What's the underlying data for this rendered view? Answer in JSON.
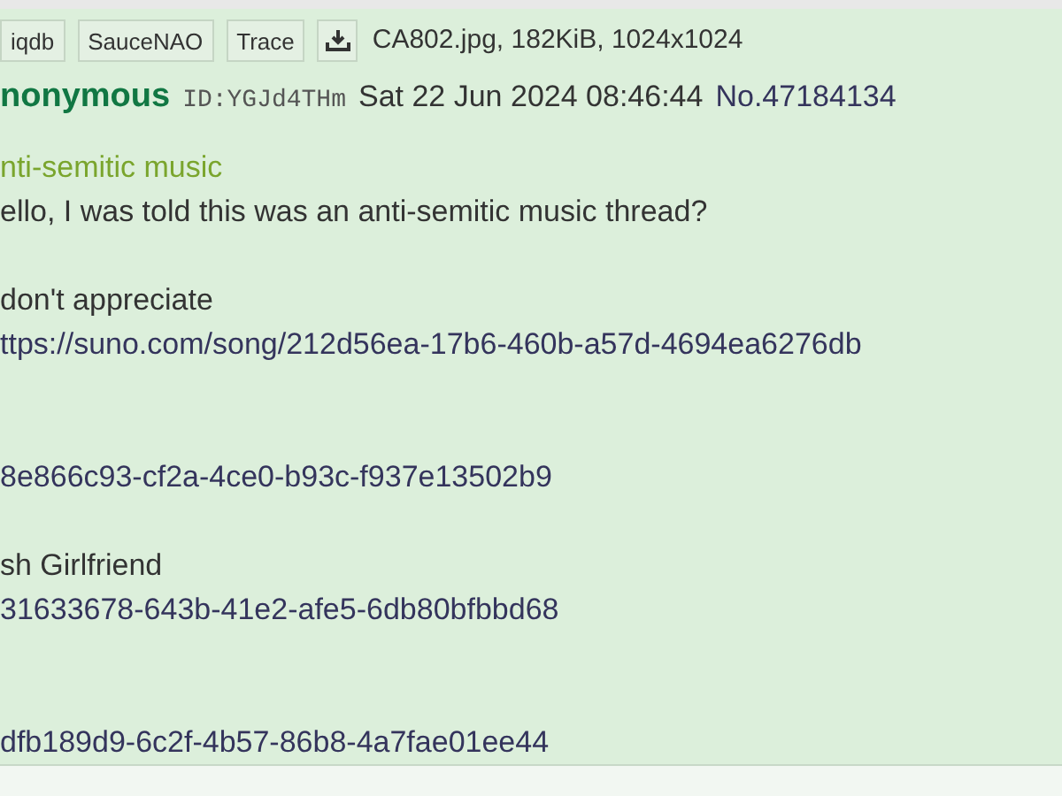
{
  "toolbar": {
    "buttons": [
      {
        "kind": "text",
        "label": "iqdb"
      },
      {
        "kind": "text",
        "label": "SauceNAO"
      },
      {
        "kind": "text",
        "label": "Trace"
      },
      {
        "kind": "download"
      }
    ],
    "file_info": "CA802.jpg, 182KiB, 1024x1024"
  },
  "post": {
    "name": "nonymous",
    "id": "ID:YGJd4THm",
    "date": "Sat 22 Jun 2024 08:46:44",
    "number": "No.47184134",
    "subject": "nti-semitic music",
    "lines": [
      {
        "kind": "text",
        "text": "ello, I was told this was an anti-semitic music thread?"
      },
      {
        "kind": "blank"
      },
      {
        "kind": "text",
        "text": "don't appreciate"
      },
      {
        "kind": "link",
        "text": "ttps://suno.com/song/212d56ea-17b6-460b-a57d-4694ea6276db"
      },
      {
        "kind": "blank"
      },
      {
        "kind": "blank"
      },
      {
        "kind": "link",
        "text": "8e866c93-cf2a-4ce0-b93c-f937e13502b9"
      },
      {
        "kind": "blank"
      },
      {
        "kind": "text",
        "text": "sh Girlfriend"
      },
      {
        "kind": "link",
        "text": "31633678-643b-41e2-afe5-6db80bfbbd68"
      },
      {
        "kind": "blank"
      },
      {
        "kind": "blank"
      },
      {
        "kind": "link",
        "text": "dfb189d9-6c2f-4b57-86b8-4a7fae01ee44"
      }
    ]
  }
}
